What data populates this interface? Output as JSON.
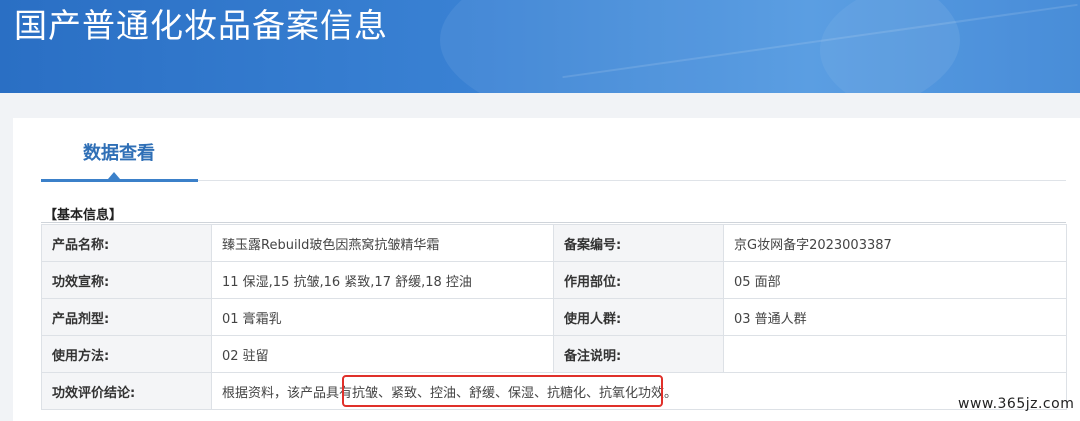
{
  "banner": {
    "title": "国产普通化妆品备案信息"
  },
  "tabs": [
    {
      "label": "数据查看"
    }
  ],
  "section": {
    "title": "【基本信息】"
  },
  "rows": [
    [
      {
        "label": "产品名称:",
        "value": "臻玉露Rebuild玻色因燕窝抗皱精华霜"
      },
      {
        "label": "备案编号:",
        "value": "京G妆网备字2023003387"
      }
    ],
    [
      {
        "label": "功效宣称:",
        "value": "11 保湿,15 抗皱,16 紧致,17 舒缓,18 控油"
      },
      {
        "label": "作用部位:",
        "value": "05 面部"
      }
    ],
    [
      {
        "label": "产品剂型:",
        "value": "01 膏霜乳"
      },
      {
        "label": "使用人群:",
        "value": "03 普通人群"
      }
    ],
    [
      {
        "label": "使用方法:",
        "value": "02 驻留"
      },
      {
        "label": "备注说明:",
        "value": ""
      }
    ]
  ],
  "conclusion": {
    "label": "功效评价结论:",
    "value": "根据资料，该产品具有抗皱、紧致、控油、舒缓、保湿、抗糖化、抗氧化功效。"
  },
  "watermark": "www.365jz.com",
  "colors": {
    "banner": "#3a82d4",
    "tab_accent": "#3b80c9",
    "highlight": "#e0302a"
  }
}
